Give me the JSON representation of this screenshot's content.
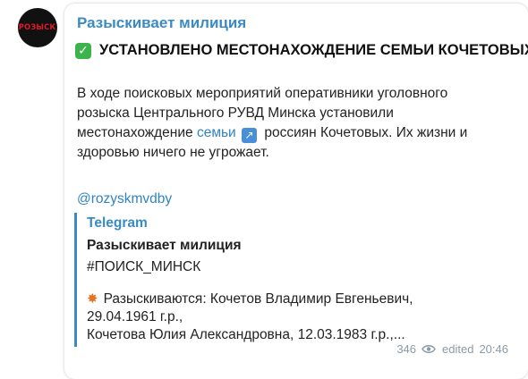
{
  "channel": {
    "avatar_text": "РОЗЫСК",
    "name": "Разыскивает милиция"
  },
  "post": {
    "headline": "УСТАНОВЛЕНО МЕСТОНАХОЖДЕНИЕ СЕМЬИ КОЧЕТОВЫХ!",
    "body": {
      "line1": "В ходе поисковых мероприятий оперативники уголовного",
      "line2": "розыска Центрального РУВД Минска установили",
      "line3_before": "местонахождение ",
      "line3_link": "семьи",
      "line3_after": " россиян Кочетовых. Их жизни и",
      "line4": "здоровью ничего не угрожает."
    },
    "handle": "@rozyskmvdby"
  },
  "link_preview": {
    "site_name": "Telegram",
    "title": "Разыскивает милиция",
    "tag": "#ПОИСК_МИНСК",
    "desc_line1": "Разыскиваются: Кочетов Владимир Евгеньевич,",
    "desc_line2": "29.04.1961 г.р.,",
    "desc_line3": "Кочетова Юлия Александровна, 12.03.1983 г.р.,..."
  },
  "meta": {
    "views": "346",
    "edited_label": "edited",
    "time": "20:46"
  },
  "icons": {
    "check": "check-mark-icon",
    "external_link": "external-link-arrow-icon",
    "collision": "collision-icon",
    "views": "eye-icon"
  },
  "colors": {
    "accent": "#3b8ac4",
    "link": "#2f83c3",
    "check_green": "#3cb44b",
    "avatar_bg": "#111111",
    "avatar_text": "#e0182a",
    "meta_gray": "#8a9aa6"
  }
}
